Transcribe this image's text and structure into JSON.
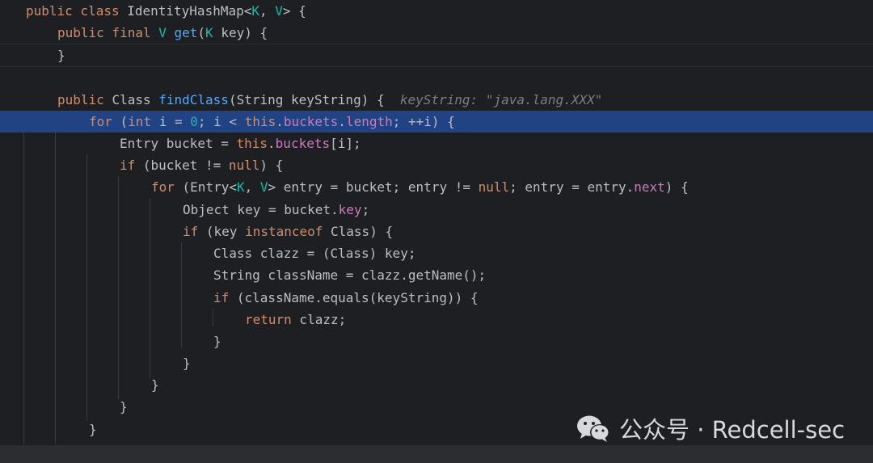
{
  "lines": [
    {
      "segments": [
        {
          "t": "public class ",
          "c": "kw"
        },
        {
          "t": "IdentityHashMap<",
          "c": ""
        },
        {
          "t": "K",
          "c": "tp"
        },
        {
          "t": ", ",
          "c": ""
        },
        {
          "t": "V",
          "c": "tp"
        },
        {
          "t": "> {",
          "c": ""
        }
      ]
    },
    {
      "segments": [
        {
          "t": "public final ",
          "c": "kw"
        },
        {
          "t": "V ",
          "c": "tp"
        },
        {
          "t": "get",
          "c": "fn"
        },
        {
          "t": "(",
          "c": ""
        },
        {
          "t": "K",
          "c": "tp"
        },
        {
          "t": " key) {",
          "c": ""
        }
      ]
    },
    {
      "segments": [
        {
          "t": "}",
          "c": ""
        }
      ]
    },
    {
      "segments": []
    },
    {
      "segments": [
        {
          "t": "public ",
          "c": "kw"
        },
        {
          "t": "Class ",
          "c": ""
        },
        {
          "t": "findClass",
          "c": "fn"
        },
        {
          "t": "(String keyString) {",
          "c": ""
        },
        {
          "t": "  keyString: \"java.lang.XXX\"",
          "c": "hint"
        }
      ]
    },
    {
      "segments": [
        {
          "t": "for",
          "c": "kw"
        },
        {
          "t": " (",
          "c": ""
        },
        {
          "t": "int",
          "c": "kw"
        },
        {
          "t": " i = ",
          "c": ""
        },
        {
          "t": "0",
          "c": "num"
        },
        {
          "t": "; i < ",
          "c": ""
        },
        {
          "t": "this",
          "c": "kw"
        },
        {
          "t": ".",
          "c": ""
        },
        {
          "t": "buckets",
          "c": "fd"
        },
        {
          "t": ".",
          "c": ""
        },
        {
          "t": "length",
          "c": "fd"
        },
        {
          "t": "; ++i) {",
          "c": ""
        }
      ]
    },
    {
      "segments": [
        {
          "t": "Entry bucket = ",
          "c": ""
        },
        {
          "t": "this",
          "c": "kw"
        },
        {
          "t": ".",
          "c": ""
        },
        {
          "t": "buckets",
          "c": "fd"
        },
        {
          "t": "[i];",
          "c": ""
        }
      ]
    },
    {
      "segments": [
        {
          "t": "if",
          "c": "kw"
        },
        {
          "t": " (bucket != ",
          "c": ""
        },
        {
          "t": "null",
          "c": "kw"
        },
        {
          "t": ") {",
          "c": ""
        }
      ]
    },
    {
      "segments": [
        {
          "t": "for",
          "c": "kw"
        },
        {
          "t": " (Entry<",
          "c": ""
        },
        {
          "t": "K",
          "c": "tp"
        },
        {
          "t": ", ",
          "c": ""
        },
        {
          "t": "V",
          "c": "tp"
        },
        {
          "t": "> entry = bucket; entry != ",
          "c": ""
        },
        {
          "t": "null",
          "c": "kw"
        },
        {
          "t": "; entry = entry.",
          "c": ""
        },
        {
          "t": "next",
          "c": "fd"
        },
        {
          "t": ") {",
          "c": ""
        }
      ]
    },
    {
      "segments": [
        {
          "t": "Object key = bucket.",
          "c": ""
        },
        {
          "t": "key",
          "c": "fd"
        },
        {
          "t": ";",
          "c": ""
        }
      ]
    },
    {
      "segments": [
        {
          "t": "if",
          "c": "kw"
        },
        {
          "t": " (key ",
          "c": ""
        },
        {
          "t": "instanceof",
          "c": "kw"
        },
        {
          "t": " Class) {",
          "c": ""
        }
      ]
    },
    {
      "segments": [
        {
          "t": "Class clazz = (Class) key;",
          "c": ""
        }
      ]
    },
    {
      "segments": [
        {
          "t": "String className = clazz.getName();",
          "c": ""
        }
      ]
    },
    {
      "segments": [
        {
          "t": "if",
          "c": "kw"
        },
        {
          "t": " (className.equals(keyString)) {",
          "c": ""
        }
      ]
    },
    {
      "segments": [
        {
          "t": "return",
          "c": "kw"
        },
        {
          "t": " clazz;",
          "c": ""
        }
      ]
    },
    {
      "segments": [
        {
          "t": "}",
          "c": ""
        }
      ]
    },
    {
      "segments": [
        {
          "t": "}",
          "c": ""
        }
      ]
    },
    {
      "segments": [
        {
          "t": "}",
          "c": ""
        }
      ]
    },
    {
      "segments": [
        {
          "t": "}",
          "c": ""
        }
      ]
    },
    {
      "segments": [
        {
          "t": "}",
          "c": ""
        }
      ]
    }
  ],
  "watermark": {
    "text": "公众号 · Redcell-sec",
    "icon": "wechat-icon"
  },
  "colors": {
    "background": "#1e1f22",
    "highlight": "#214283",
    "keyword": "#cf8e6d",
    "function": "#56a8f5",
    "type_param": "#16baac",
    "field": "#c77dbb",
    "number": "#2aacb8",
    "hint": "#7a7e85"
  }
}
